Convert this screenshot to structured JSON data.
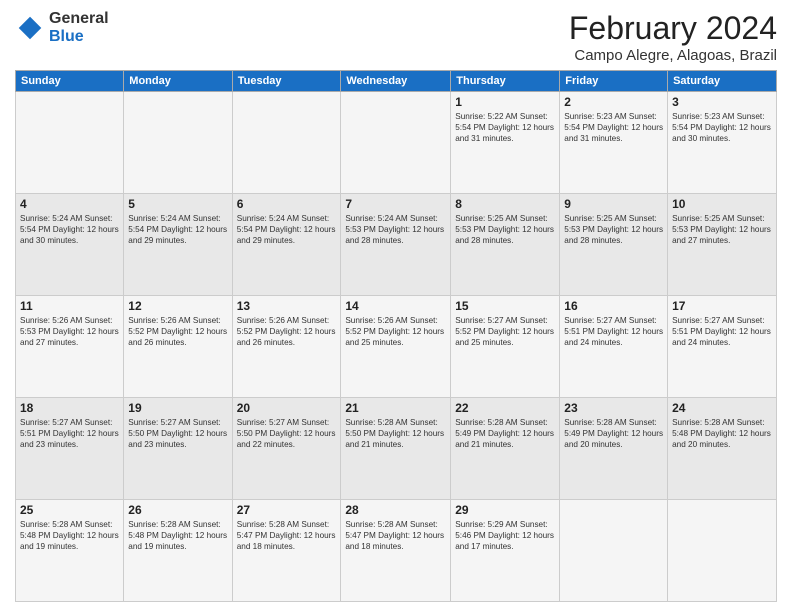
{
  "header": {
    "logo_general": "General",
    "logo_blue": "Blue",
    "month_year": "February 2024",
    "location": "Campo Alegre, Alagoas, Brazil"
  },
  "weekdays": [
    "Sunday",
    "Monday",
    "Tuesday",
    "Wednesday",
    "Thursday",
    "Friday",
    "Saturday"
  ],
  "weeks": [
    [
      {
        "day": "",
        "info": ""
      },
      {
        "day": "",
        "info": ""
      },
      {
        "day": "",
        "info": ""
      },
      {
        "day": "",
        "info": ""
      },
      {
        "day": "1",
        "info": "Sunrise: 5:22 AM\nSunset: 5:54 PM\nDaylight: 12 hours\nand 31 minutes."
      },
      {
        "day": "2",
        "info": "Sunrise: 5:23 AM\nSunset: 5:54 PM\nDaylight: 12 hours\nand 31 minutes."
      },
      {
        "day": "3",
        "info": "Sunrise: 5:23 AM\nSunset: 5:54 PM\nDaylight: 12 hours\nand 30 minutes."
      }
    ],
    [
      {
        "day": "4",
        "info": "Sunrise: 5:24 AM\nSunset: 5:54 PM\nDaylight: 12 hours\nand 30 minutes."
      },
      {
        "day": "5",
        "info": "Sunrise: 5:24 AM\nSunset: 5:54 PM\nDaylight: 12 hours\nand 29 minutes."
      },
      {
        "day": "6",
        "info": "Sunrise: 5:24 AM\nSunset: 5:54 PM\nDaylight: 12 hours\nand 29 minutes."
      },
      {
        "day": "7",
        "info": "Sunrise: 5:24 AM\nSunset: 5:53 PM\nDaylight: 12 hours\nand 28 minutes."
      },
      {
        "day": "8",
        "info": "Sunrise: 5:25 AM\nSunset: 5:53 PM\nDaylight: 12 hours\nand 28 minutes."
      },
      {
        "day": "9",
        "info": "Sunrise: 5:25 AM\nSunset: 5:53 PM\nDaylight: 12 hours\nand 28 minutes."
      },
      {
        "day": "10",
        "info": "Sunrise: 5:25 AM\nSunset: 5:53 PM\nDaylight: 12 hours\nand 27 minutes."
      }
    ],
    [
      {
        "day": "11",
        "info": "Sunrise: 5:26 AM\nSunset: 5:53 PM\nDaylight: 12 hours\nand 27 minutes."
      },
      {
        "day": "12",
        "info": "Sunrise: 5:26 AM\nSunset: 5:52 PM\nDaylight: 12 hours\nand 26 minutes."
      },
      {
        "day": "13",
        "info": "Sunrise: 5:26 AM\nSunset: 5:52 PM\nDaylight: 12 hours\nand 26 minutes."
      },
      {
        "day": "14",
        "info": "Sunrise: 5:26 AM\nSunset: 5:52 PM\nDaylight: 12 hours\nand 25 minutes."
      },
      {
        "day": "15",
        "info": "Sunrise: 5:27 AM\nSunset: 5:52 PM\nDaylight: 12 hours\nand 25 minutes."
      },
      {
        "day": "16",
        "info": "Sunrise: 5:27 AM\nSunset: 5:51 PM\nDaylight: 12 hours\nand 24 minutes."
      },
      {
        "day": "17",
        "info": "Sunrise: 5:27 AM\nSunset: 5:51 PM\nDaylight: 12 hours\nand 24 minutes."
      }
    ],
    [
      {
        "day": "18",
        "info": "Sunrise: 5:27 AM\nSunset: 5:51 PM\nDaylight: 12 hours\nand 23 minutes."
      },
      {
        "day": "19",
        "info": "Sunrise: 5:27 AM\nSunset: 5:50 PM\nDaylight: 12 hours\nand 23 minutes."
      },
      {
        "day": "20",
        "info": "Sunrise: 5:27 AM\nSunset: 5:50 PM\nDaylight: 12 hours\nand 22 minutes."
      },
      {
        "day": "21",
        "info": "Sunrise: 5:28 AM\nSunset: 5:50 PM\nDaylight: 12 hours\nand 21 minutes."
      },
      {
        "day": "22",
        "info": "Sunrise: 5:28 AM\nSunset: 5:49 PM\nDaylight: 12 hours\nand 21 minutes."
      },
      {
        "day": "23",
        "info": "Sunrise: 5:28 AM\nSunset: 5:49 PM\nDaylight: 12 hours\nand 20 minutes."
      },
      {
        "day": "24",
        "info": "Sunrise: 5:28 AM\nSunset: 5:48 PM\nDaylight: 12 hours\nand 20 minutes."
      }
    ],
    [
      {
        "day": "25",
        "info": "Sunrise: 5:28 AM\nSunset: 5:48 PM\nDaylight: 12 hours\nand 19 minutes."
      },
      {
        "day": "26",
        "info": "Sunrise: 5:28 AM\nSunset: 5:48 PM\nDaylight: 12 hours\nand 19 minutes."
      },
      {
        "day": "27",
        "info": "Sunrise: 5:28 AM\nSunset: 5:47 PM\nDaylight: 12 hours\nand 18 minutes."
      },
      {
        "day": "28",
        "info": "Sunrise: 5:28 AM\nSunset: 5:47 PM\nDaylight: 12 hours\nand 18 minutes."
      },
      {
        "day": "29",
        "info": "Sunrise: 5:29 AM\nSunset: 5:46 PM\nDaylight: 12 hours\nand 17 minutes."
      },
      {
        "day": "",
        "info": ""
      },
      {
        "day": "",
        "info": ""
      }
    ]
  ]
}
